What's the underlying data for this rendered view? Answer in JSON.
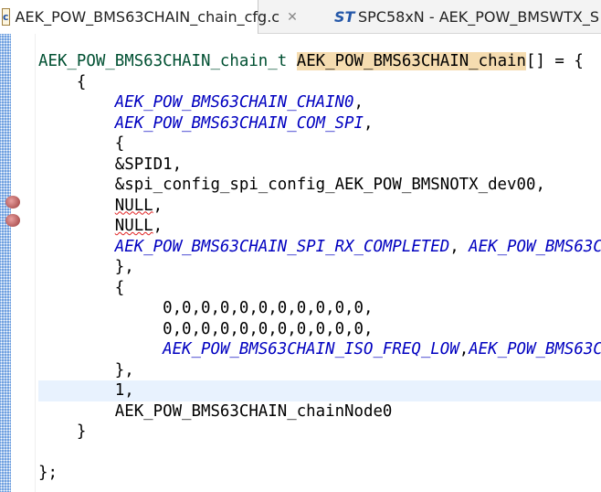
{
  "tabs": [
    {
      "label": "AEK_POW_BMS63CHAIN_chain_cfg.c",
      "icon": "c-file-icon",
      "active": true
    },
    {
      "label": "SPC58xN - AEK_POW_BMSWTX_S",
      "icon": "st-logo-icon",
      "active": false
    }
  ],
  "code": {
    "l0_type": "AEK_POW_BMS63CHAIN_chain_t",
    "l0_name": "AEK_POW_BMS63CHAIN_chain",
    "l0_rest": "[] = {",
    "l1": "    {",
    "l2": "AEK_POW_BMS63CHAIN_CHAIN0",
    "l3": "AEK_POW_BMS63CHAIN_COM_SPI",
    "l4": "        {",
    "l5": "        &SPID1,",
    "l6": "        &spi_config_spi_config_AEK_POW_BMSNOTX_dev00,",
    "l7": "NULL",
    "l8": "NULL",
    "l9a": "AEK_POW_BMS63CHAIN_SPI_RX_COMPLETED",
    "l9b": "AEK_POW_BMS63C",
    "l10": "        },",
    "l11": "        {",
    "l12": "             0,0,0,0,0,0,0,0,0,0,0,",
    "l13": "             0,0,0,0,0,0,0,0,0,0,0,",
    "l14a": "AEK_POW_BMS63CHAIN_ISO_FREQ_LOW",
    "l14b": "AEK_POW_BMS63C",
    "l15": "        },",
    "l16": "        1,",
    "l17": "        AEK_POW_BMS63CHAIN_chainNode0",
    "l18": "    }",
    "l19": "",
    "l20": "};"
  }
}
